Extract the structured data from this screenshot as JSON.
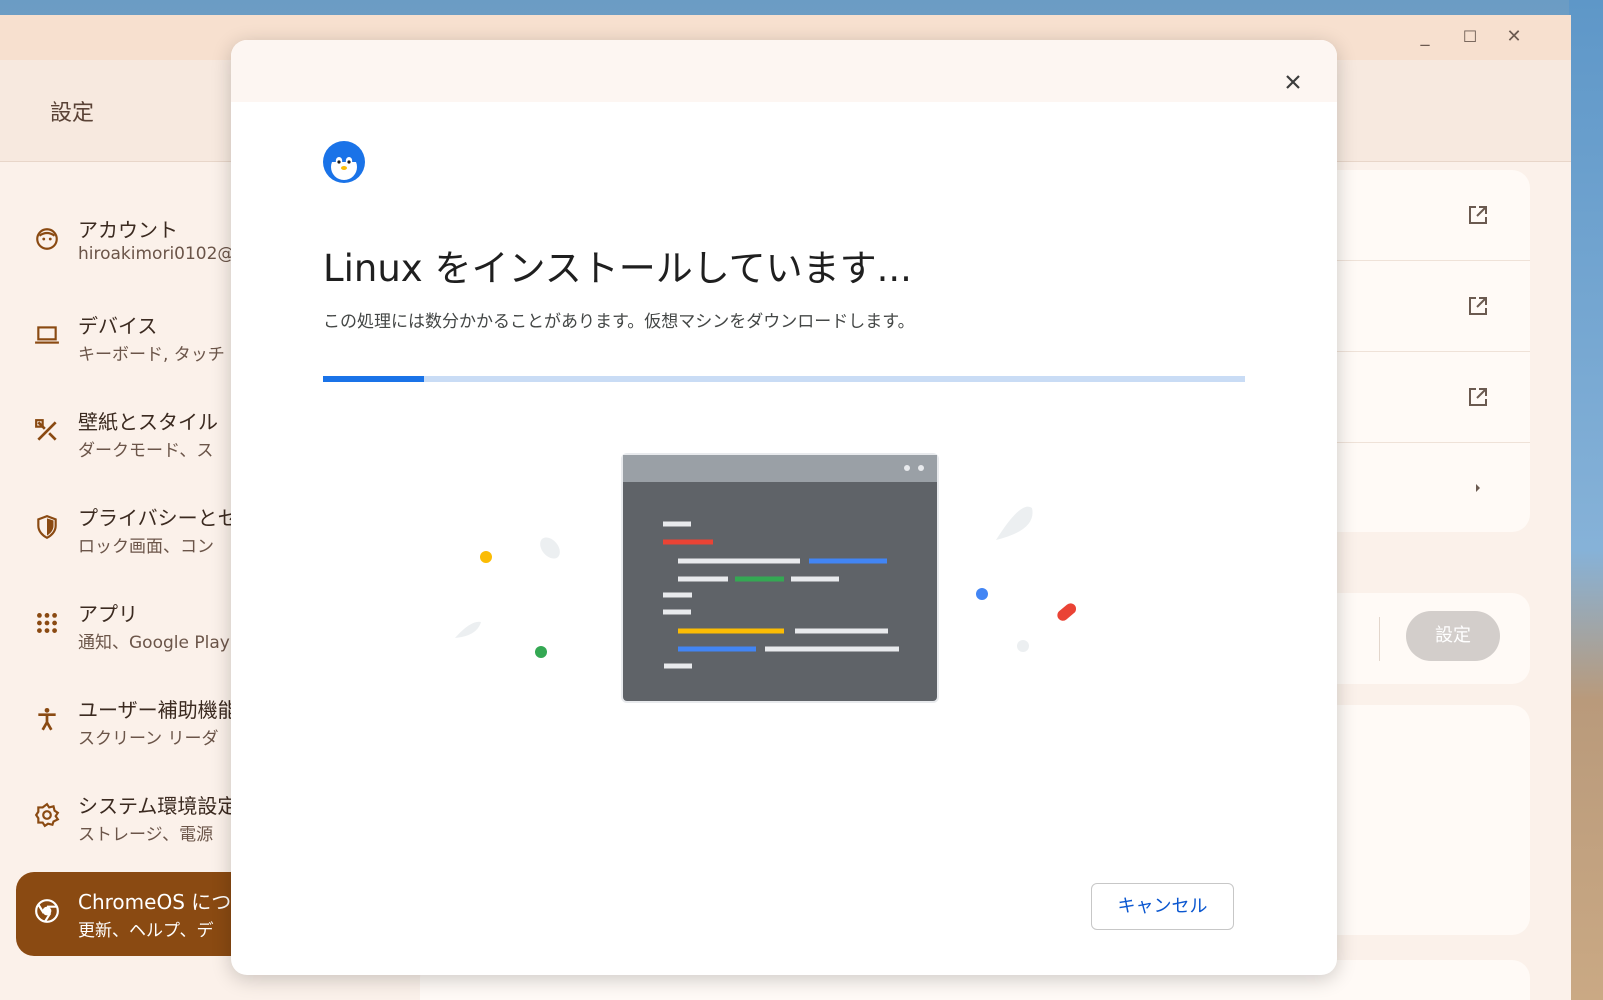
{
  "window": {
    "title": "設定",
    "controls": {
      "minimize": "_",
      "maximize": "☐",
      "close": "✕"
    }
  },
  "sidebar": {
    "items": [
      {
        "icon": "face-icon",
        "title": "アカウント",
        "subtitle": "hiroakimori0102@"
      },
      {
        "icon": "laptop-icon",
        "title": "デバイス",
        "subtitle": "キーボード, タッチ"
      },
      {
        "icon": "palette-icon",
        "title": "壁紙とスタイル",
        "subtitle": "ダークモード、ス"
      },
      {
        "icon": "shield-icon",
        "title": "プライバシーとセ",
        "subtitle": "ロック画面、コン"
      },
      {
        "icon": "apps-grid-icon",
        "title": "アプリ",
        "subtitle": "通知、Google Play"
      },
      {
        "icon": "accessibility-icon",
        "title": "ユーザー補助機能",
        "subtitle": "スクリーン リーダ"
      },
      {
        "icon": "gear-icon",
        "title": "システム環境設定",
        "subtitle": "ストレージ、電源"
      },
      {
        "icon": "chrome-icon",
        "title": "ChromeOS につ",
        "subtitle": "更新、ヘルプ、デ",
        "active": true
      }
    ]
  },
  "main": {
    "setting_button": "設定"
  },
  "dialog": {
    "title": "Linux をインストールしています...",
    "description": "この処理には数分かかることがあります。仮想マシンをダウンロードします。",
    "progress": 0.11,
    "cancel_label": "キャンセル",
    "icon": "penguin-icon"
  },
  "colors": {
    "accent": "#1a73e8",
    "active_nav": "#8a4a12",
    "cancel_text": "#0b57d0"
  }
}
